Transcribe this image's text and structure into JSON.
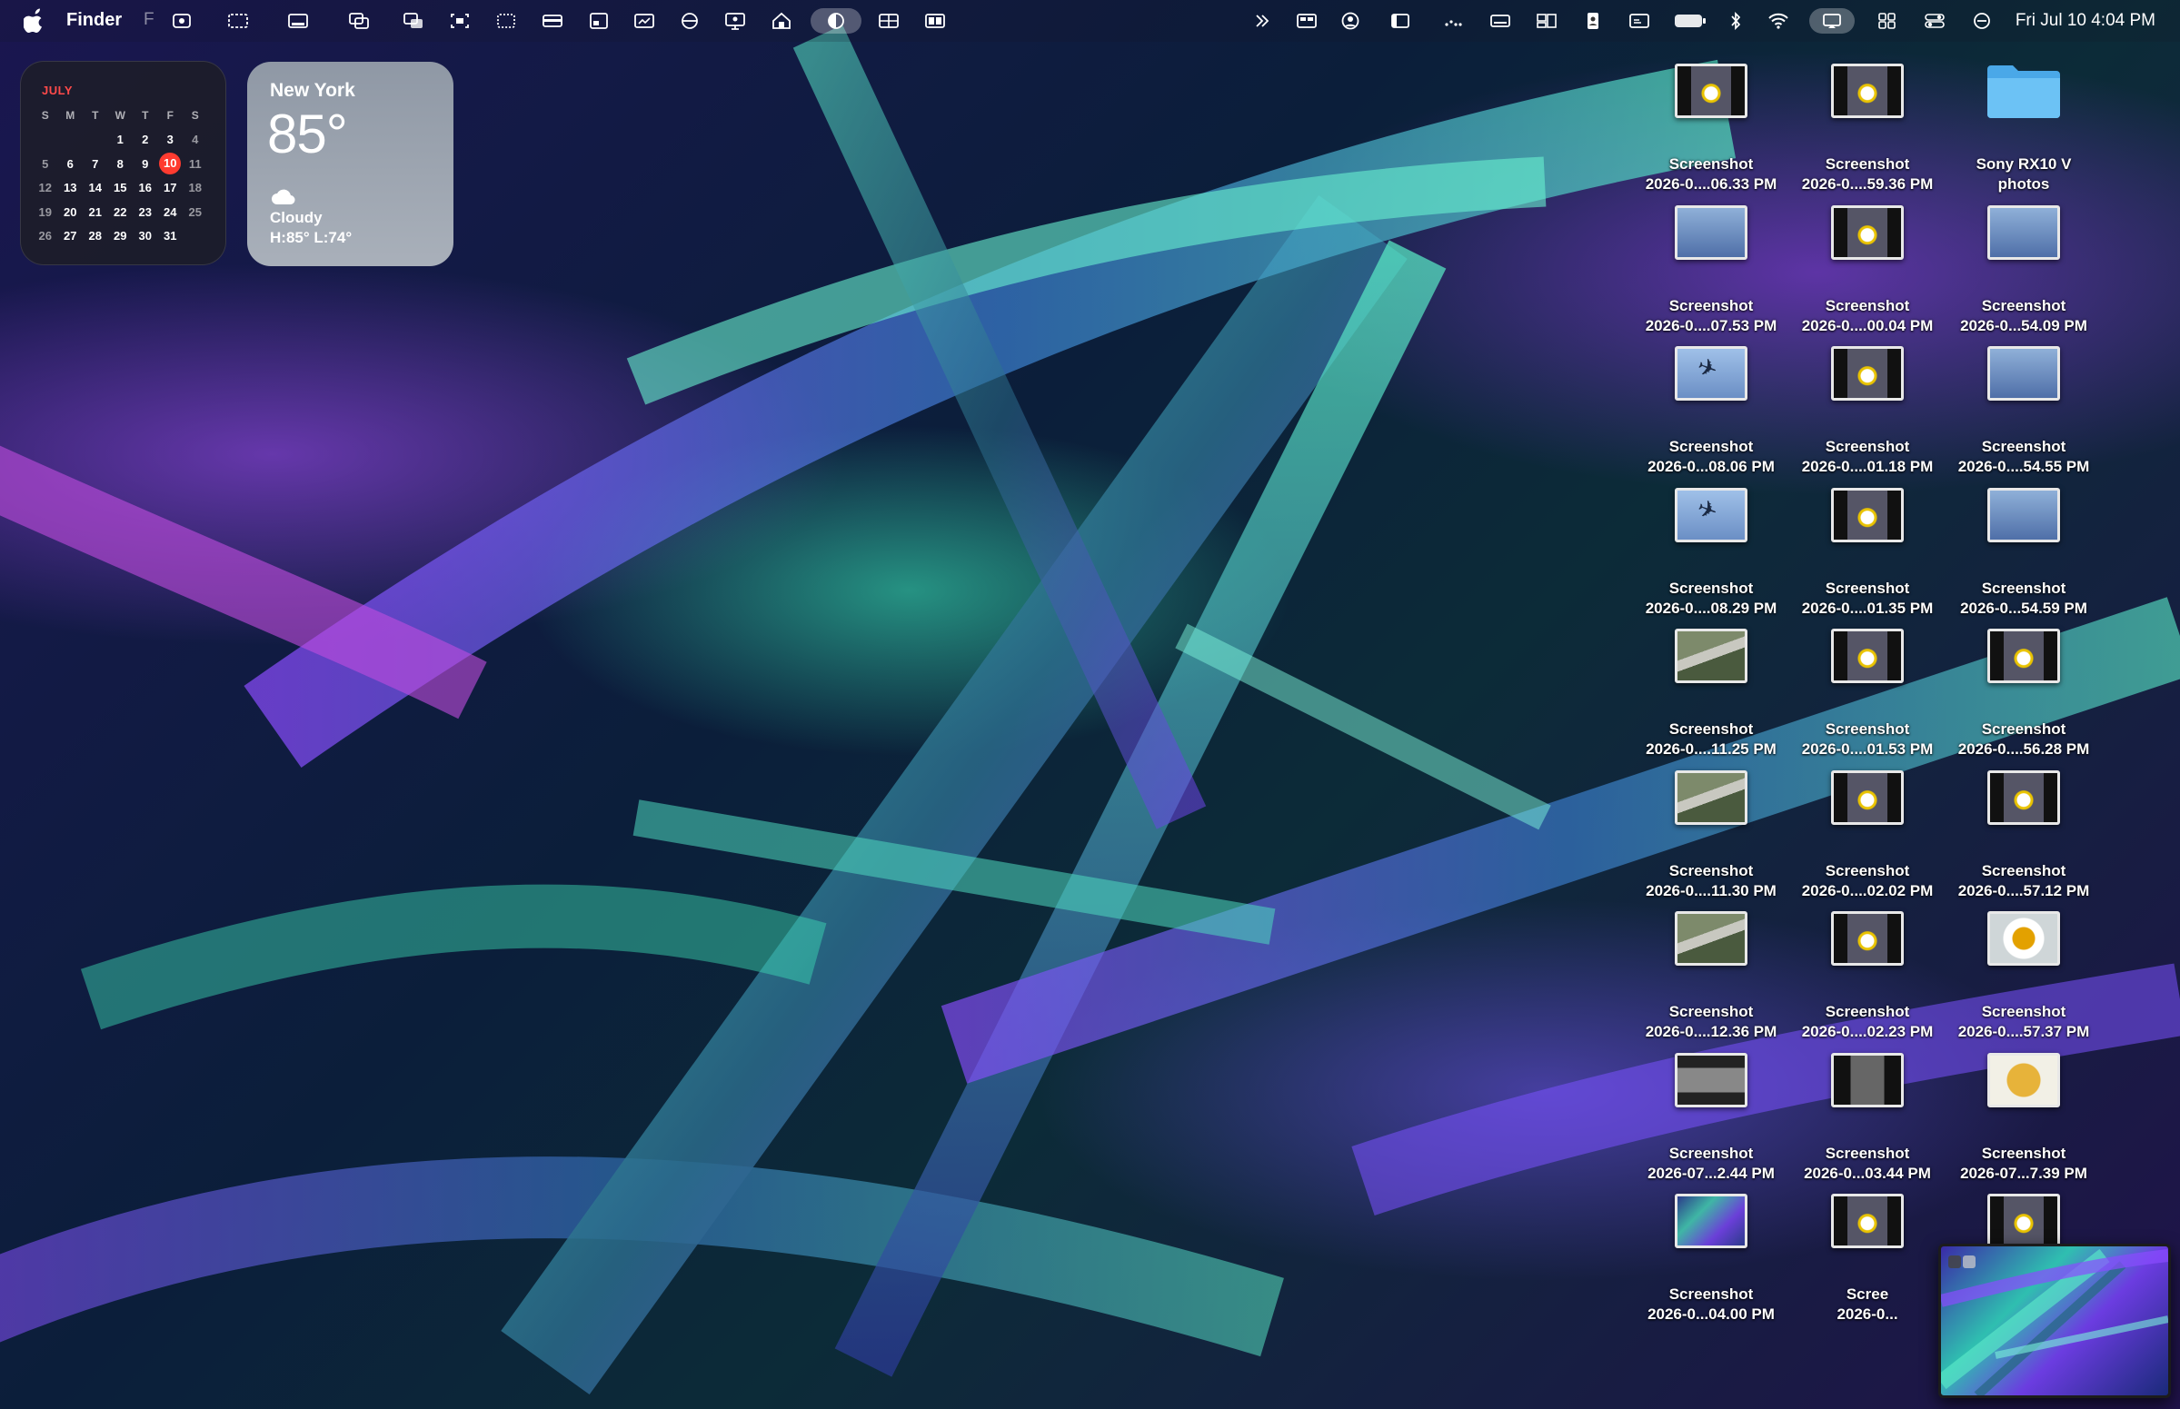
{
  "menubar": {
    "app_name": "Finder",
    "faded_menu": "F",
    "clock": "Fri Jul 10  4:04 PM",
    "status_icons": [
      "overflow-chevron-icon",
      "control-icon",
      "user-icon",
      "sidebar-icon",
      "dots-icon",
      "display-icon",
      "windows-icon",
      "contact-icon",
      "card-icon",
      "battery-icon",
      "bluetooth-icon",
      "wifi-icon",
      "screen-mirror-icon",
      "control-center-icon",
      "toggles-icon",
      "focus-icon"
    ],
    "left_icons": [
      "screenshot-icon",
      "window-capture-icon",
      "dock-icon",
      "stacked-windows-icon",
      "windows2-icon",
      "focus-capture-icon",
      "selection-icon",
      "bar-icon",
      "screen-icon",
      "monitor-icon",
      "half-circle-icon",
      "presentation-icon",
      "home-icon",
      "privacy-icon",
      "grid-icon",
      "split-view-icon"
    ]
  },
  "calendar": {
    "month": "JULY",
    "weekdays": [
      "S",
      "M",
      "T",
      "W",
      "T",
      "F",
      "S"
    ],
    "weeks": [
      [
        "",
        "",
        "",
        "1",
        "2",
        "3",
        "4"
      ],
      [
        "5",
        "6",
        "7",
        "8",
        "9",
        "10",
        "11"
      ],
      [
        "12",
        "13",
        "14",
        "15",
        "16",
        "17",
        "18"
      ],
      [
        "19",
        "20",
        "21",
        "22",
        "23",
        "24",
        "25"
      ],
      [
        "26",
        "27",
        "28",
        "29",
        "30",
        "31",
        ""
      ]
    ],
    "today": "10"
  },
  "weather": {
    "city": "New York",
    "temp": "85°",
    "condition": "Cloudy",
    "hilo": "H:85° L:74°"
  },
  "desktop_icons": [
    {
      "l1": "Screenshot",
      "l2": "2026-0....06.33 PM",
      "thumb": "flower"
    },
    {
      "l1": "Screenshot",
      "l2": "2026-0....59.36 PM",
      "thumb": "flower"
    },
    {
      "l1": "Sony RX10 V",
      "l2": "photos",
      "thumb": "folder"
    },
    {
      "l1": "Screenshot",
      "l2": "2026-0....07.53 PM",
      "thumb": "screen"
    },
    {
      "l1": "Screenshot",
      "l2": "2026-0....00.04 PM",
      "thumb": "flower"
    },
    {
      "l1": "Screenshot",
      "l2": "2026-0...54.09 PM",
      "thumb": "screen"
    },
    {
      "l1": "Screenshot",
      "l2": "2026-0...08.06 PM",
      "thumb": "plane"
    },
    {
      "l1": "Screenshot",
      "l2": "2026-0....01.18 PM",
      "thumb": "flower"
    },
    {
      "l1": "Screenshot",
      "l2": "2026-0....54.55 PM",
      "thumb": "screen"
    },
    {
      "l1": "Screenshot",
      "l2": "2026-0....08.29 PM",
      "thumb": "plane"
    },
    {
      "l1": "Screenshot",
      "l2": "2026-0....01.35 PM",
      "thumb": "flower"
    },
    {
      "l1": "Screenshot",
      "l2": "2026-0...54.59 PM",
      "thumb": "screen"
    },
    {
      "l1": "Screenshot",
      "l2": "2026-0....11.25 PM",
      "thumb": "street"
    },
    {
      "l1": "Screenshot",
      "l2": "2026-0....01.53 PM",
      "thumb": "flower"
    },
    {
      "l1": "Screenshot",
      "l2": "2026-0....56.28 PM",
      "thumb": "flower"
    },
    {
      "l1": "Screenshot",
      "l2": "2026-0....11.30 PM",
      "thumb": "street"
    },
    {
      "l1": "Screenshot",
      "l2": "2026-0....02.02 PM",
      "thumb": "flower"
    },
    {
      "l1": "Screenshot",
      "l2": "2026-0....57.12 PM",
      "thumb": "flower"
    },
    {
      "l1": "Screenshot",
      "l2": "2026-0....12.36 PM",
      "thumb": "street"
    },
    {
      "l1": "Screenshot",
      "l2": "2026-0....02.23 PM",
      "thumb": "flower"
    },
    {
      "l1": "Screenshot",
      "l2": "2026-0....57.37 PM",
      "thumb": "bee"
    },
    {
      "l1": "Screenshot",
      "l2": "2026-07...2.44 PM",
      "thumb": "dark"
    },
    {
      "l1": "Screenshot",
      "l2": "2026-0...03.44 PM",
      "thumb": "dark2"
    },
    {
      "l1": "Screenshot",
      "l2": "2026-07...7.39 PM",
      "thumb": "pinwheel"
    },
    {
      "l1": "Screenshot",
      "l2": "2026-0...04.00 PM",
      "thumb": "teal"
    },
    {
      "l1": "Scree",
      "l2": "2026-0...",
      "thumb": "flower"
    },
    {
      "l1": "",
      "l2": "",
      "thumb": "flower"
    }
  ],
  "preview": {
    "name": "screenshot-preview-thumbnail"
  }
}
